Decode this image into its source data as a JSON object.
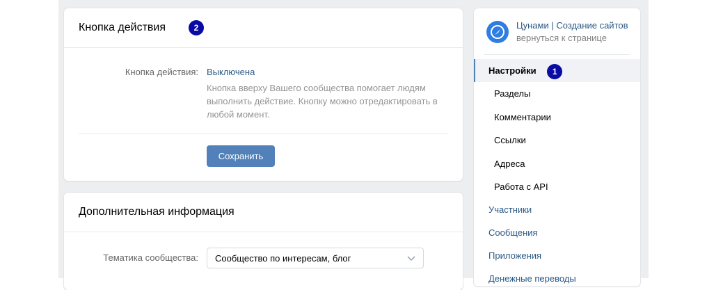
{
  "action_card": {
    "title": "Кнопка действия",
    "badge": "2",
    "row_label": "Кнопка действия:",
    "row_value": "Выключена",
    "description": "Кнопка вверху Вашего сообщества помогает людям выполнить действие. Кнопку можно отредактировать в любой момент.",
    "save_label": "Сохранить"
  },
  "extra_card": {
    "title": "Дополнительная информация",
    "theme_label": "Тематика сообщества:",
    "theme_value": "Сообщество по интересам, блог"
  },
  "nav": {
    "community_name": "Цунами | Создание сайтов",
    "back_link": "вернуться к странице",
    "items": [
      {
        "label": "Настройки",
        "badge": "1"
      },
      {
        "label": "Разделы"
      },
      {
        "label": "Комментарии"
      },
      {
        "label": "Ссылки"
      },
      {
        "label": "Адреса"
      },
      {
        "label": "Работа с API"
      },
      {
        "label": "Участники"
      },
      {
        "label": "Сообщения"
      },
      {
        "label": "Приложения"
      },
      {
        "label": "Денежные переводы"
      }
    ]
  },
  "colors": {
    "accent": "#5181b8",
    "link": "#2a5885",
    "badge": "#0a0aa4",
    "page_bg": "#edeef0"
  }
}
